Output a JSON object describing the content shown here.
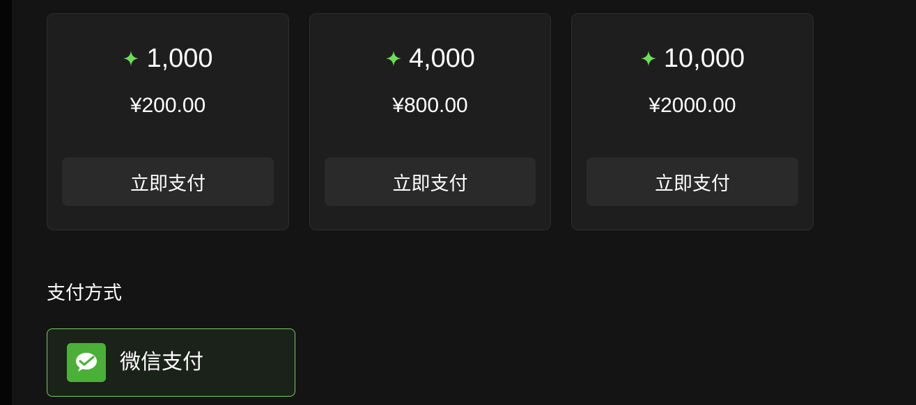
{
  "packages": [
    {
      "credits": "1,000",
      "price": "¥200.00",
      "button_label": "立即支付"
    },
    {
      "credits": "4,000",
      "price": "¥800.00",
      "button_label": "立即支付"
    },
    {
      "credits": "10,000",
      "price": "¥2000.00",
      "button_label": "立即支付"
    }
  ],
  "payment": {
    "section_title": "支付方式",
    "methods": [
      {
        "label": "微信支付",
        "icon": "wechat-pay-icon",
        "selected": true
      }
    ]
  },
  "colors": {
    "background": "#141414",
    "card_background": "#1e1e1e",
    "button_background": "#2a2a2a",
    "accent_green": "#77cf63",
    "sparkle_green": "#6fdc59",
    "wechat_green": "#4caf3a"
  },
  "icons": {
    "credit": "sparkle-icon",
    "payment": "wechat-pay-icon"
  }
}
